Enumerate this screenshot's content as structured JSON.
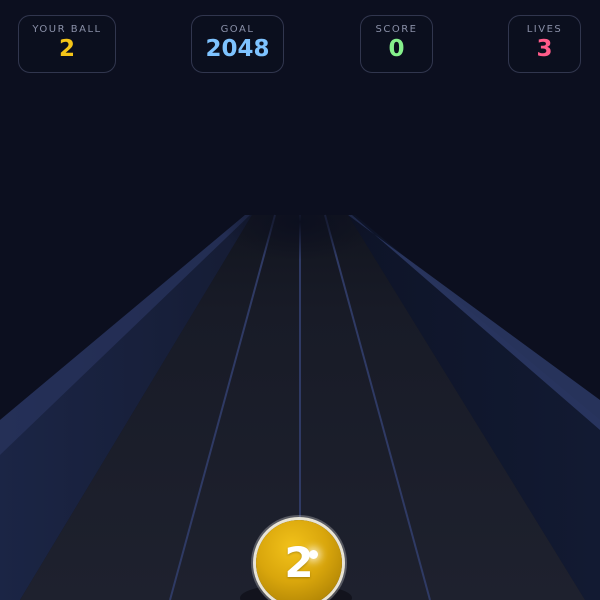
{
  "hud": {
    "your_ball": {
      "label": "YOUR BALL",
      "value": "2",
      "color": "#f5c518"
    },
    "goal": {
      "label": "GOAL",
      "value": "2048",
      "color": "#7ec3ff"
    },
    "score": {
      "label": "SCORE",
      "value": "0",
      "color": "#86f08c"
    },
    "lives": {
      "label": "LIVES",
      "value": "3",
      "color": "#ff5c8a"
    }
  },
  "player_ball": {
    "number": "2",
    "color": "#d9a60c"
  },
  "track": {
    "lanes": 4,
    "floor_color": "#1b1e2c",
    "wall_color": "#1c2542",
    "lane_line_color": "#3a4570"
  }
}
